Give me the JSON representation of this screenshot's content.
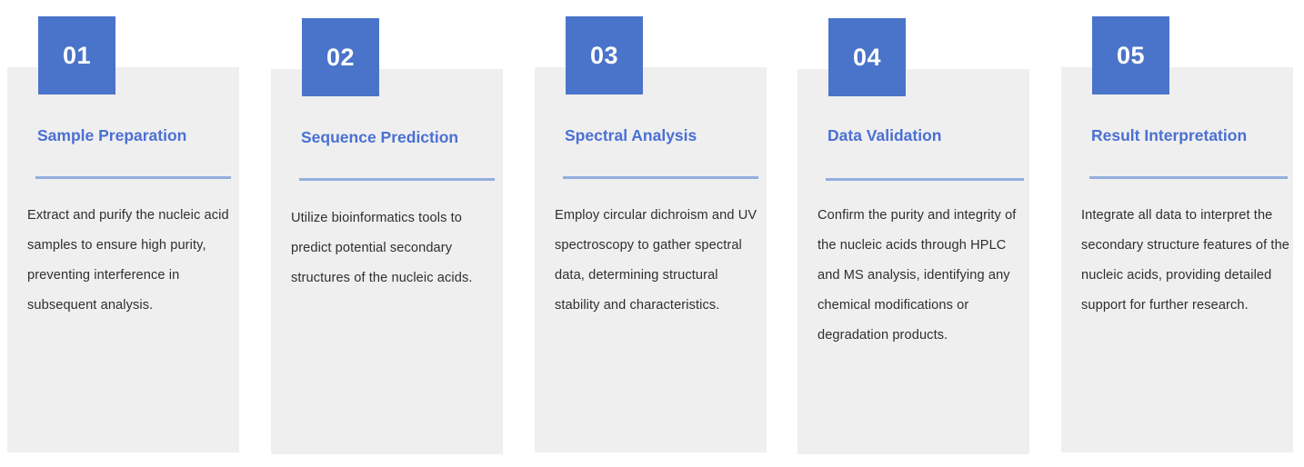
{
  "page": {
    "background": "#ffffff",
    "accent_blue": "#4a74c9",
    "title_blue": "#4a70d2",
    "divider_blue": "#93aedd",
    "panel_gray": "#efeff0",
    "body_text": "#2f2f2f"
  },
  "steps": [
    {
      "number": "01",
      "title": "Sample Preparation",
      "body": "Extract and purify the nucleic acid samples to ensure high purity, preventing interference in subsequent analysis."
    },
    {
      "number": "02",
      "title": "Sequence Prediction",
      "body": "Utilize bioinformatics tools to predict potential secondary structures of the nucleic acids."
    },
    {
      "number": "03",
      "title": "Spectral Analysis",
      "body": "Employ circular dichroism and UV spectroscopy to gather spectral data, determining structural stability and characteristics."
    },
    {
      "number": "04",
      "title": "Data Validation",
      "body": "Confirm the purity and integrity of the nucleic acids through HPLC and MS analysis, identifying any chemical modifications or degradation products."
    },
    {
      "number": "05",
      "title": "Result Interpretation",
      "body": "Integrate all data to interpret the secondary structure features of the nucleic acids, providing detailed support for further research."
    }
  ]
}
